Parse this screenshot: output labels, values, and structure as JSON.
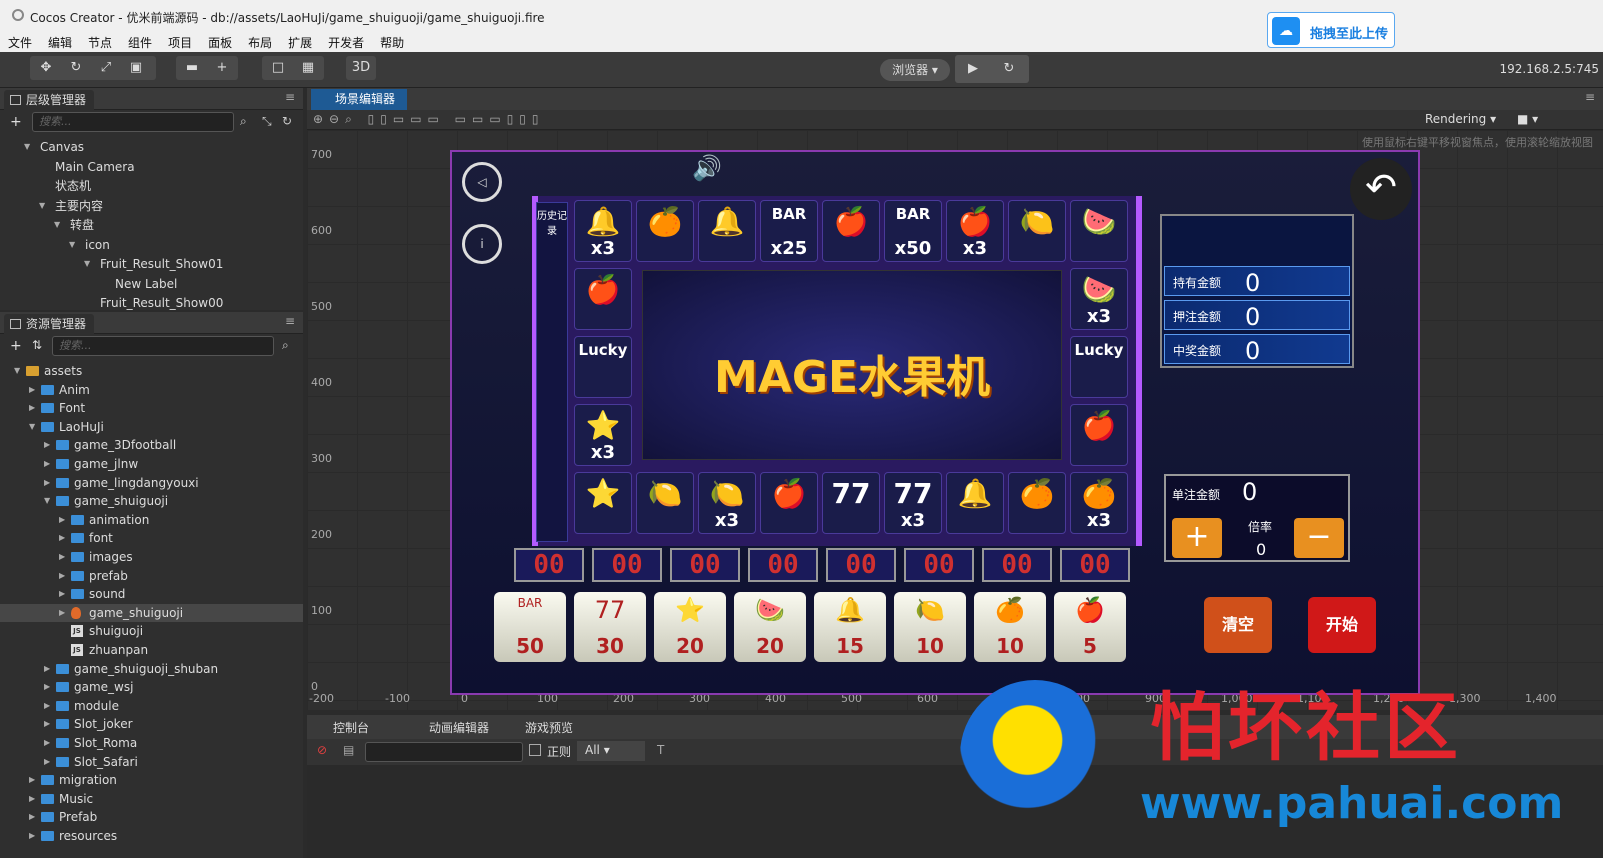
{
  "window": {
    "title": "Cocos Creator - 优米前端源码 - db://assets/LaoHuJi/game_shuiguoji/game_shuiguoji.fire"
  },
  "upload": {
    "label": "拖拽至此上传"
  },
  "menu": [
    "文件",
    "编辑",
    "节点",
    "组件",
    "项目",
    "面板",
    "布局",
    "扩展",
    "开发者",
    "帮助"
  ],
  "toolbar": {
    "mode_3d": "3D",
    "browser": "浏览器 ▾",
    "ip": "192.168.2.5:745"
  },
  "hierarchy": {
    "title": "层级管理器",
    "search_placeholder": "搜索...",
    "nodes": [
      {
        "label": "Canvas",
        "depth": 0,
        "expanded": true
      },
      {
        "label": "Main Camera",
        "depth": 1
      },
      {
        "label": "状态机",
        "depth": 1
      },
      {
        "label": "主要内容",
        "depth": 1,
        "expanded": true
      },
      {
        "label": "转盘",
        "depth": 2,
        "expanded": true
      },
      {
        "label": "icon",
        "depth": 3,
        "expanded": true
      },
      {
        "label": "Fruit_Result_Show01",
        "depth": 4,
        "expanded": true
      },
      {
        "label": "New Label",
        "depth": 5
      },
      {
        "label": "Fruit_Result_Show00",
        "depth": 4
      }
    ]
  },
  "assets": {
    "title": "资源管理器",
    "search_placeholder": "搜索...",
    "items": [
      {
        "label": "assets",
        "depth": 0,
        "type": "root",
        "expanded": true
      },
      {
        "label": "Anim",
        "depth": 1,
        "type": "folder"
      },
      {
        "label": "Font",
        "depth": 1,
        "type": "folder"
      },
      {
        "label": "LaoHuJi",
        "depth": 1,
        "type": "folder",
        "expanded": true
      },
      {
        "label": "game_3Dfootball",
        "depth": 2,
        "type": "folder"
      },
      {
        "label": "game_jlnw",
        "depth": 2,
        "type": "folder"
      },
      {
        "label": "game_lingdangyouxi",
        "depth": 2,
        "type": "folder"
      },
      {
        "label": "game_shuiguoji",
        "depth": 2,
        "type": "folder",
        "expanded": true
      },
      {
        "label": "animation",
        "depth": 3,
        "type": "folder"
      },
      {
        "label": "font",
        "depth": 3,
        "type": "folder"
      },
      {
        "label": "images",
        "depth": 3,
        "type": "folder"
      },
      {
        "label": "prefab",
        "depth": 3,
        "type": "folder"
      },
      {
        "label": "sound",
        "depth": 3,
        "type": "folder"
      },
      {
        "label": "game_shuiguoji",
        "depth": 3,
        "type": "fire",
        "selected": true
      },
      {
        "label": "shuiguoji",
        "depth": 3,
        "type": "js"
      },
      {
        "label": "zhuanpan",
        "depth": 3,
        "type": "js"
      },
      {
        "label": "game_shuiguoji_shuban",
        "depth": 2,
        "type": "folder"
      },
      {
        "label": "game_wsj",
        "depth": 2,
        "type": "folder"
      },
      {
        "label": "module",
        "depth": 2,
        "type": "folder"
      },
      {
        "label": "Slot_joker",
        "depth": 2,
        "type": "folder"
      },
      {
        "label": "Slot_Roma",
        "depth": 2,
        "type": "folder"
      },
      {
        "label": "Slot_Safari",
        "depth": 2,
        "type": "folder"
      },
      {
        "label": "migration",
        "depth": 1,
        "type": "folder"
      },
      {
        "label": "Music",
        "depth": 1,
        "type": "folder"
      },
      {
        "label": "Prefab",
        "depth": 1,
        "type": "folder"
      },
      {
        "label": "resources",
        "depth": 1,
        "type": "folder"
      }
    ]
  },
  "scene": {
    "tab": "场景编辑器",
    "rendering": "Rendering ▾",
    "hint": "使用鼠标右键平移视窗焦点，使用滚轮缩放视图",
    "y_ticks": [
      "700",
      "600",
      "500",
      "400",
      "300",
      "200",
      "100",
      "0"
    ],
    "x_ticks": [
      "-200",
      "-100",
      "0",
      "100",
      "200",
      "300",
      "400",
      "500",
      "600",
      "700",
      "800",
      "900",
      "1,000",
      "1,100",
      "1,200",
      "1,300",
      "1,400"
    ]
  },
  "game": {
    "logo": "MAGE水果机",
    "history": "历史记录",
    "top_row": [
      {
        "s": "🔔",
        "m": "x3"
      },
      {
        "s": "🍊",
        "m": ""
      },
      {
        "s": "🔔",
        "m": ""
      },
      {
        "s": "BAR",
        "m": "x25"
      },
      {
        "s": "🍎",
        "m": ""
      },
      {
        "s": "BAR",
        "m": "x50"
      },
      {
        "s": "🍎",
        "m": "x3"
      },
      {
        "s": "🍋",
        "m": ""
      },
      {
        "s": "🍉",
        "m": ""
      }
    ],
    "left_col": [
      {
        "s": "🍎",
        "m": ""
      },
      {
        "s": "Lucky",
        "m": ""
      },
      {
        "s": "⭐",
        "m": "x3"
      }
    ],
    "right_col": [
      {
        "s": "🍉",
        "m": "x3"
      },
      {
        "s": "Lucky",
        "m": ""
      },
      {
        "s": "🍎",
        "m": ""
      }
    ],
    "bottom_row": [
      {
        "s": "⭐",
        "m": ""
      },
      {
        "s": "🍋",
        "m": ""
      },
      {
        "s": "🍋",
        "m": "x3"
      },
      {
        "s": "🍎",
        "m": ""
      },
      {
        "s": "77",
        "m": ""
      },
      {
        "s": "77",
        "m": "x3"
      },
      {
        "s": "🔔",
        "m": ""
      },
      {
        "s": "🍊",
        "m": ""
      },
      {
        "s": "🍊",
        "m": "x3"
      }
    ],
    "info": [
      {
        "k": "持有金额",
        "v": "0"
      },
      {
        "k": "押注金额",
        "v": "0"
      },
      {
        "k": "中奖金额",
        "v": "0"
      }
    ],
    "single_bet": {
      "k": "单注金额",
      "v": "0"
    },
    "rate": {
      "k": "倍率",
      "v": "0"
    },
    "plus": "+",
    "minus": "−",
    "leds": [
      "00",
      "00",
      "00",
      "00",
      "00",
      "00",
      "00",
      "00"
    ],
    "bets": [
      {
        "s": "BAR",
        "n": "50"
      },
      {
        "s": "77",
        "n": "30"
      },
      {
        "s": "⭐",
        "n": "20"
      },
      {
        "s": "🍉",
        "n": "20"
      },
      {
        "s": "🔔",
        "n": "15"
      },
      {
        "s": "🍋",
        "n": "10"
      },
      {
        "s": "🍊",
        "n": "10"
      },
      {
        "s": "🍎",
        "n": "5"
      }
    ],
    "clear": "清空",
    "start": "开始"
  },
  "dock": {
    "tabs": [
      "控制台",
      "动画编辑器",
      "游戏预览"
    ],
    "regex": "正则",
    "filter": "All ▾"
  },
  "watermark": {
    "text": "怕坏社区",
    "url": "www.pahuai.com"
  },
  "colors": {
    "accent": "#1e5a94",
    "folder": "#3b8fd8",
    "red": "#e4242c"
  }
}
